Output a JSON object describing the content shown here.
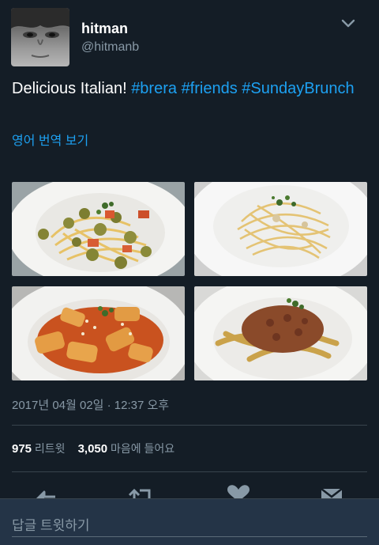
{
  "tweet": {
    "display_name": "hitman",
    "handle": "@hitmanb",
    "text_plain": "Delicious Italian! ",
    "hashtags": [
      "#brera",
      "#friends",
      "#SundayBrunch"
    ],
    "translate_link": "영어 번역 보기",
    "timestamp": "2017년 04월 02일 · 12:37 오후"
  },
  "stats": {
    "retweets_count": "975",
    "retweets_label": "리트윗",
    "likes_count": "3,050",
    "likes_label": "마음에 들어요"
  },
  "media": [
    {
      "name": "pasta with olives and tomatoes"
    },
    {
      "name": "spaghetti carbonara"
    },
    {
      "name": "rigatoni with tomato sauce"
    },
    {
      "name": "tagliatelle bolognese"
    }
  ],
  "actions": [
    "reply-icon",
    "retweet-icon",
    "like-icon",
    "message-icon"
  ],
  "reply_bar": {
    "placeholder": "답글 트윗하기"
  },
  "colors": {
    "background": "#141d26",
    "accent": "#1da1f2",
    "secondary_text": "#8899a6",
    "reply_bar": "#243447"
  }
}
